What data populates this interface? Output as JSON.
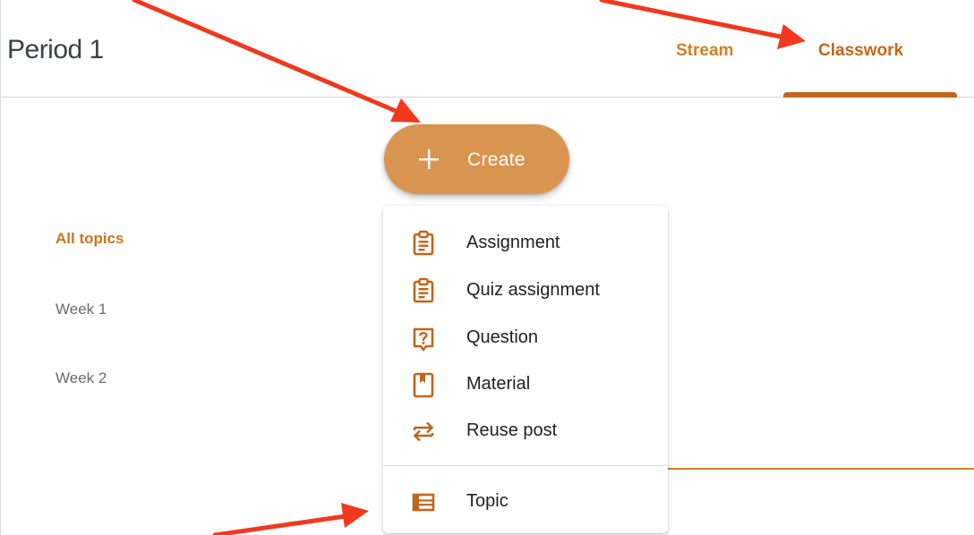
{
  "header": {
    "class_title": "Period 1",
    "tabs": [
      {
        "label": "Stream",
        "active": false
      },
      {
        "label": "Classwork",
        "active": true
      }
    ]
  },
  "create_button": {
    "icon": "plus-icon",
    "label": "Create"
  },
  "topics": {
    "items": [
      {
        "label": "All topics",
        "selected": true
      },
      {
        "label": "Week 1",
        "selected": false
      },
      {
        "label": "Week 2",
        "selected": false
      }
    ]
  },
  "create_menu": {
    "items": [
      {
        "label": "Assignment",
        "icon": "assignment-icon"
      },
      {
        "label": "Quiz assignment",
        "icon": "quiz-assignment-icon"
      },
      {
        "label": "Question",
        "icon": "question-icon"
      },
      {
        "label": "Material",
        "icon": "material-icon"
      },
      {
        "label": "Reuse post",
        "icon": "reuse-post-icon"
      },
      {
        "label": "Topic",
        "icon": "topic-icon"
      }
    ]
  },
  "colors": {
    "accent": "#d47f2a",
    "accent_dark": "#c0651c",
    "create_button": "#d99550",
    "annotation_arrow": "#f0391e",
    "icon": "#c0651c"
  }
}
